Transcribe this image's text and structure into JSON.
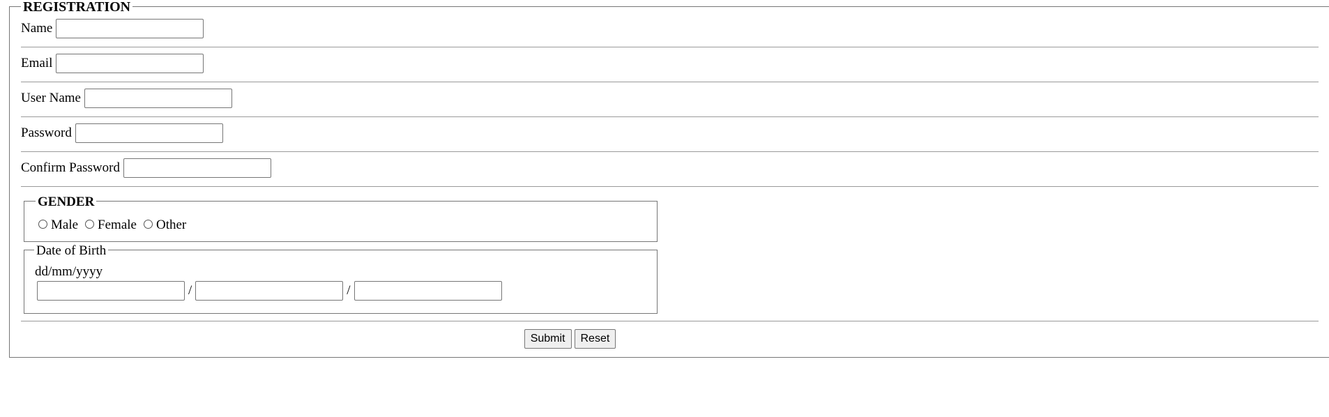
{
  "form": {
    "title": "REGISTRATION",
    "fields": {
      "name_label": "Name",
      "name_value": "",
      "email_label": "Email",
      "email_value": "",
      "username_label": "User Name",
      "username_value": "",
      "password_label": "Password",
      "password_value": "",
      "confirm_password_label": "Confirm Password",
      "confirm_password_value": ""
    },
    "gender": {
      "title": "GENDER",
      "options": [
        "Male",
        "Female",
        "Other"
      ]
    },
    "dob": {
      "title": "Date of Birth",
      "hint": "dd/mm/yyyy",
      "separator": "/",
      "day_value": "",
      "month_value": "",
      "year_value": ""
    },
    "buttons": {
      "submit_label": "Submit",
      "reset_label": "Reset"
    }
  }
}
